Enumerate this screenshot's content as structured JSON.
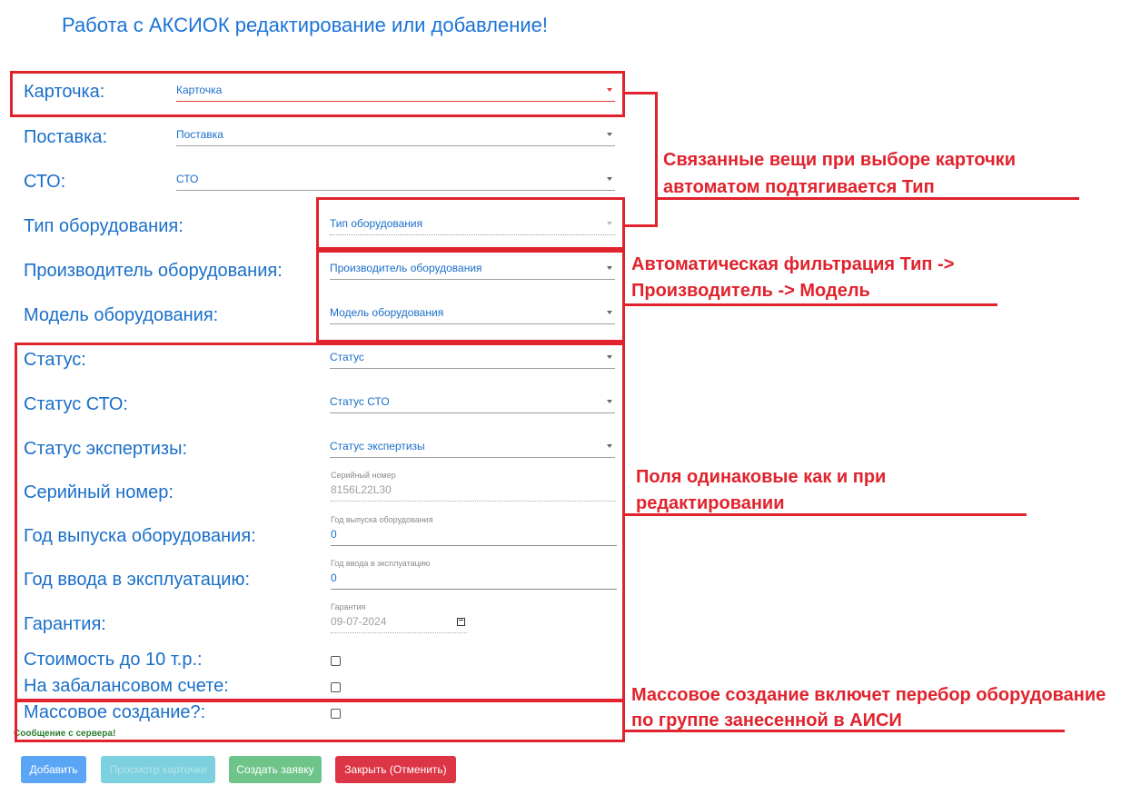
{
  "title": "Работа с АКСИОК редактирование или добавление!",
  "fields": {
    "card": {
      "label": "Карточка:",
      "value": "Карточка"
    },
    "delivery": {
      "label": "Поставка:",
      "value": "Поставка"
    },
    "sto": {
      "label": "СТО:",
      "value": "СТО"
    },
    "equipment_type": {
      "label": "Тип оборудования:",
      "value": "Тип оборудования"
    },
    "manufacturer": {
      "label": "Производитель оборудования:",
      "value": "Производитель оборудования"
    },
    "model": {
      "label": "Модель оборудования:",
      "value": "Модель оборудования"
    },
    "status": {
      "label": "Статус:",
      "value": "Статус"
    },
    "status_sto": {
      "label": "Статус СТО:",
      "value": "Статус СТО"
    },
    "status_expertise": {
      "label": "Статус экспертизы:",
      "value": "Статус экспертизы"
    },
    "serial": {
      "label": "Серийный номер:",
      "field_label": "Серийный номер",
      "value": "8156L22L30"
    },
    "year_made": {
      "label": "Год выпуска оборудования:",
      "field_label": "Год выпуска оборудования",
      "value": "0"
    },
    "year_commission": {
      "label": "Год ввода в эксплуатацию:",
      "field_label": "Год ввода в эксплуатацию",
      "value": "0"
    },
    "warranty": {
      "label": "Гарантия:",
      "field_label": "Гарантия",
      "value": "09-07-2024"
    },
    "cost_under_10k": {
      "label": "Стоимость до 10 т.р.:",
      "checked": false
    },
    "off_balance": {
      "label": "На забалансовом счете:",
      "checked": false
    },
    "mass_create": {
      "label": "Массовое создание?:",
      "checked": false
    }
  },
  "server_message": "Сообщение с сервера!",
  "buttons": {
    "add": "Добавить",
    "view_card": "Просмотр карточки",
    "create_request": "Создать заявку",
    "close": "Закрыть (Отменить)"
  },
  "annotations": {
    "a1_line1": "Связанные вещи при выборе карточки",
    "a1_line2": "автоматом подтягивается Тип",
    "a2_line1": "Автоматическая фильтрация Тип ->",
    "a2_line2": "Производитель -> Модель",
    "a3_line1": "Поля одинаковые как и при",
    "a3_line2": "редактировании",
    "a4_line1": "Массовое создание включет перебор оборудование",
    "a4_line2": "по группе занесенной в АИСИ"
  },
  "colors": {
    "label_blue": "#1a6fc9",
    "title_blue": "#1a73d8",
    "annotation_red": "#e0232d",
    "btn_add": "#5aa5f5",
    "btn_view": "#7dd0de",
    "btn_create": "#6fc48a",
    "btn_close": "#dc3545"
  }
}
